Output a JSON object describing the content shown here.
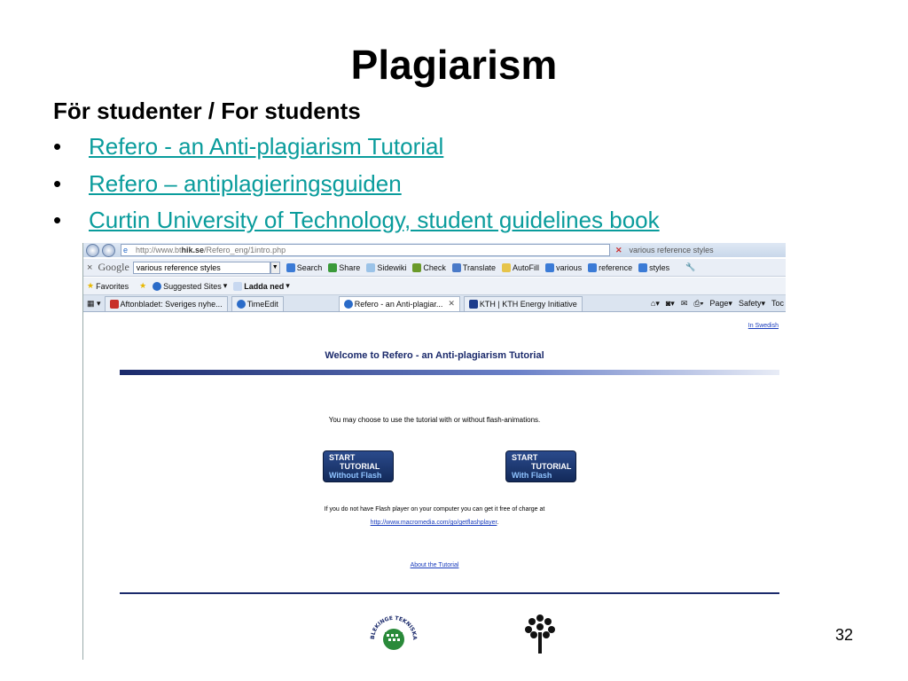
{
  "slide": {
    "title": "Plagiarism",
    "subtitle": "För studenter / For students",
    "bullet_char": "•",
    "bullets": [
      {
        "label": "Refero - an Anti-plagiarism Tutorial"
      },
      {
        "label": "Refero – antiplagieringsguiden"
      },
      {
        "label": "Curtin University of Technology, student guidelines book"
      }
    ],
    "page_number": "32"
  },
  "browser": {
    "address": {
      "prefix": "http://www.bt",
      "host": "hik.se",
      "path": "/Refero_eng/1intro.php"
    },
    "search_box": "various reference styles",
    "google_toolbar": {
      "close": "×",
      "logo": "Google",
      "query": "various reference styles",
      "items": [
        "Search",
        "Share",
        "Sidewiki",
        "Check",
        "Translate",
        "AutoFill",
        "various",
        "reference",
        "styles"
      ]
    },
    "favorites_bar": {
      "favorites": "Favorites",
      "suggested": "Suggested Sites",
      "ladda": "Ladda ned"
    },
    "tabs": [
      {
        "label": "Aftonbladet: Sveriges nyhe..."
      },
      {
        "label": "TimeEdit"
      },
      {
        "label": "Refero - an Anti-plagiar..."
      },
      {
        "label": "KTH | KTH Energy Initiative"
      }
    ],
    "command_bar": {
      "page": "Page",
      "safety": "Safety",
      "tools": "Toc"
    },
    "page": {
      "in_swedish": "In Swedish",
      "heading": "Welcome to Refero - an Anti-plagiarism Tutorial",
      "choose_text": "You may choose to use the tutorial with or without flash-animations.",
      "btn_without": {
        "line1": "START",
        "line2": "TUTORIAL",
        "line3": "Without Flash"
      },
      "btn_with": {
        "line1": "START",
        "line2": "TUTORIAL",
        "line3": "With Flash"
      },
      "flash_text": "If you do not have Flash player on your computer you can get it free of charge at",
      "flash_link": "http://www.macromedia.com/go/getflashplayer",
      "about_link": "About the Tutorial",
      "logo_text": "BLEKINGE TEKNISKA HÖGSKOLA · BTH ·"
    }
  }
}
